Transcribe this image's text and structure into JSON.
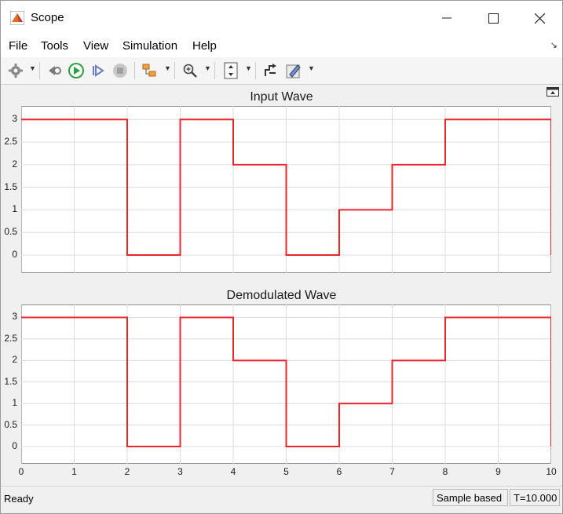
{
  "window": {
    "title": "Scope"
  },
  "menu": [
    "File",
    "Tools",
    "View",
    "Simulation",
    "Help"
  ],
  "colors": {
    "signal": "#e8272d",
    "grid": "#dcdcdc",
    "axes_bg": "#ffffff"
  },
  "toolbar_icons": [
    "gear-icon",
    "step-back-icon",
    "run-icon",
    "step-forward-icon",
    "stop-icon",
    "highlight-block-icon",
    "zoom-icon",
    "autoscale-icon",
    "cursor-measure-icon",
    "edit-icon"
  ],
  "status": {
    "left": "Ready",
    "mode": "Sample based",
    "time": "T=10.000"
  },
  "chart_data": [
    {
      "type": "line",
      "title": "Input Wave",
      "step": true,
      "x": [
        0,
        1,
        2,
        3,
        4,
        5,
        6,
        7,
        8,
        9,
        10
      ],
      "y": [
        3,
        3,
        0,
        3,
        2,
        0,
        1,
        2,
        3,
        3,
        3
      ],
      "xlim": [
        0,
        10
      ],
      "ylim": [
        -0.4,
        3.3
      ],
      "yticks": [
        "0",
        "0.5",
        "1",
        "1.5",
        "2",
        "2.5",
        "3"
      ],
      "grid": true
    },
    {
      "type": "line",
      "title": "Demodulated Wave",
      "step": true,
      "x": [
        0,
        1,
        2,
        3,
        4,
        5,
        6,
        7,
        8,
        9,
        10
      ],
      "y": [
        3,
        3,
        0,
        3,
        2,
        0,
        1,
        2,
        3,
        3,
        3
      ],
      "xlim": [
        0,
        10
      ],
      "ylim": [
        -0.4,
        3.3
      ],
      "yticks": [
        "0",
        "0.5",
        "1",
        "1.5",
        "2",
        "2.5",
        "3"
      ],
      "xticks": [
        "0",
        "1",
        "2",
        "3",
        "4",
        "5",
        "6",
        "7",
        "8",
        "9",
        "10"
      ],
      "grid": true
    }
  ]
}
